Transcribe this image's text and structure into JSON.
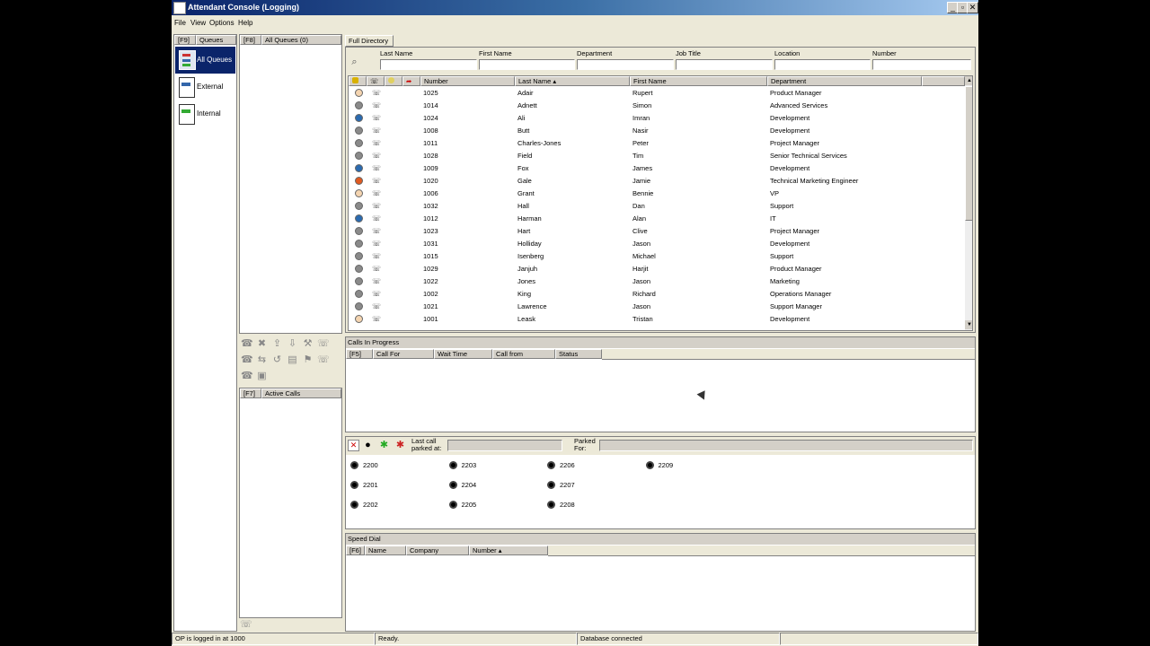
{
  "window": {
    "title": "Attendant Console (Logging)"
  },
  "menu": [
    "File",
    "View",
    "Options",
    "Help"
  ],
  "queues": {
    "key": "[F9]",
    "tab_label": "Queues",
    "items": [
      {
        "label": "All Queues",
        "icon": "queue-icon"
      },
      {
        "label": "External",
        "icon": "external-queue-icon"
      },
      {
        "label": "Internal",
        "icon": "internal-queue-icon"
      }
    ]
  },
  "queue_calls": {
    "key": "[F8]",
    "label": "All Queues (0)"
  },
  "active_calls": {
    "key": "[F7]",
    "label": "Active Calls"
  },
  "directory": {
    "tab": "Full Directory",
    "search_fields": [
      "Last Name",
      "First Name",
      "Department",
      "Job Title",
      "Location",
      "Number"
    ],
    "columns": [
      "Number",
      "Last Name",
      "First Name",
      "Department"
    ],
    "sort_column": "Last Name",
    "rows": [
      {
        "status": "idle",
        "number": "1025",
        "last": "Adair",
        "first": "Rupert",
        "dept": "Product Manager"
      },
      {
        "status": "away",
        "number": "1014",
        "last": "Adnett",
        "first": "Simon",
        "dept": "Advanced Services"
      },
      {
        "status": "busy-blue",
        "number": "1024",
        "last": "Ali",
        "first": "Imran",
        "dept": "Development"
      },
      {
        "status": "away",
        "number": "1008",
        "last": "Butt",
        "first": "Nasir",
        "dept": "Development"
      },
      {
        "status": "away",
        "number": "1011",
        "last": "Charles-Jones",
        "first": "Peter",
        "dept": "Project Manager"
      },
      {
        "status": "away",
        "number": "1028",
        "last": "Field",
        "first": "Tim",
        "dept": "Senior Technical Services"
      },
      {
        "status": "busy-blue",
        "number": "1009",
        "last": "Fox",
        "first": "James",
        "dept": "Development"
      },
      {
        "status": "dnd",
        "number": "1020",
        "last": "Gale",
        "first": "Jamie",
        "dept": "Technical Marketing Engineer"
      },
      {
        "status": "idle",
        "number": "1006",
        "last": "Grant",
        "first": "Bennie",
        "dept": "VP"
      },
      {
        "status": "away",
        "number": "1032",
        "last": "Hall",
        "first": "Dan",
        "dept": "Support"
      },
      {
        "status": "busy-blue",
        "number": "1012",
        "last": "Harman",
        "first": "Alan",
        "dept": "IT"
      },
      {
        "status": "away",
        "number": "1023",
        "last": "Hart",
        "first": "Clive",
        "dept": "Project Manager"
      },
      {
        "status": "away",
        "number": "1031",
        "last": "Holliday",
        "first": "Jason",
        "dept": "Development"
      },
      {
        "status": "away",
        "number": "1015",
        "last": "Isenberg",
        "first": "Michael",
        "dept": "Support"
      },
      {
        "status": "away",
        "number": "1029",
        "last": "Janjuh",
        "first": "Harjit",
        "dept": "Product Manager"
      },
      {
        "status": "away",
        "number": "1022",
        "last": "Jones",
        "first": "Jason",
        "dept": "Marketing"
      },
      {
        "status": "away",
        "number": "1002",
        "last": "King",
        "first": "Richard",
        "dept": "Operations Manager"
      },
      {
        "status": "away",
        "number": "1021",
        "last": "Lawrence",
        "first": "Jason",
        "dept": "Support Manager"
      },
      {
        "status": "idle",
        "number": "1001",
        "last": "Leask",
        "first": "Tristan",
        "dept": "Development"
      }
    ]
  },
  "calls_in_progress": {
    "title": "Calls In Progress",
    "key": "[F5]",
    "columns": [
      "Call For",
      "Wait Time",
      "Call from",
      "Status"
    ]
  },
  "park": {
    "last_call_label": "Last call parked at:",
    "parked_for_label": "Parked For:",
    "slots": [
      "2200",
      "2201",
      "2202",
      "2203",
      "2204",
      "2205",
      "2206",
      "2207",
      "2208",
      "2209"
    ]
  },
  "speed_dial": {
    "title": "Speed Dial",
    "key": "[F6]",
    "columns": [
      "Name",
      "Company",
      "Number"
    ]
  },
  "status_bar": {
    "login": "OP is logged in at 1000",
    "state": "Ready.",
    "db": "Database connected"
  },
  "colors": {
    "idle": "#f4d4b0",
    "away": "#8a8a8a",
    "busy-blue": "#2a6ab0",
    "dnd": "#e05a20",
    "selected": "#0a246a"
  }
}
